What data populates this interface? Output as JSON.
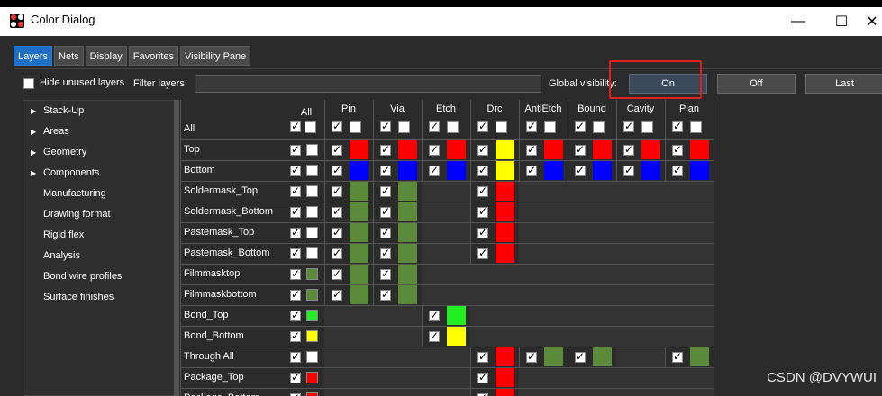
{
  "window": {
    "title": "Color Dialog",
    "controls": [
      "minimize-icon",
      "maximize-icon",
      "close-icon"
    ]
  },
  "tabs": [
    {
      "label": "Layers",
      "active": true
    },
    {
      "label": "Nets",
      "active": false
    },
    {
      "label": "Display",
      "active": false
    },
    {
      "label": "Favorites",
      "active": false
    },
    {
      "label": "Visibility Pane",
      "active": false
    }
  ],
  "filter": {
    "hide_unused_label": "Hide unused layers",
    "hide_unused_checked": false,
    "filter_label": "Filter layers:",
    "filter_value": "",
    "global_visibility_label": "Global visibility:",
    "buttons": {
      "on": "On",
      "off": "Off",
      "last": "Last"
    }
  },
  "tree": {
    "items": [
      {
        "label": "Stack-Up",
        "expandable": true
      },
      {
        "label": "Areas",
        "expandable": true
      },
      {
        "label": "Geometry",
        "expandable": true
      },
      {
        "label": "Components",
        "expandable": true
      },
      {
        "label": "Manufacturing",
        "expandable": false
      },
      {
        "label": "Drawing format",
        "expandable": false
      },
      {
        "label": "Rigid flex",
        "expandable": false
      },
      {
        "label": "Analysis",
        "expandable": false
      },
      {
        "label": "Bond wire profiles",
        "expandable": false
      },
      {
        "label": "Surface finishes",
        "expandable": false
      }
    ]
  },
  "grid": {
    "all_label": "All",
    "columns": [
      "Pin",
      "Via",
      "Etch",
      "Drc",
      "AntiEtch",
      "Bound",
      "Cavity",
      "Plan"
    ],
    "colors": {
      "red": "#ff0000",
      "blue": "#0000ff",
      "yellow": "#ffff00",
      "olive": "#5b8a3a",
      "green": "#22ee22",
      "white": "#ffffff"
    },
    "rows": [
      {
        "name": "All",
        "all_color": "white",
        "cells": [
          "white",
          "white",
          "white",
          "white",
          "white",
          "white",
          "white",
          "white"
        ]
      },
      {
        "name": "Top",
        "all_color": "white",
        "cells": [
          "red",
          "red",
          "red",
          "yellow",
          "red",
          "red",
          "red",
          "red"
        ]
      },
      {
        "name": "Bottom",
        "all_color": "white",
        "cells": [
          "blue",
          "blue",
          "blue",
          "yellow",
          "blue",
          "blue",
          "blue",
          "blue"
        ]
      },
      {
        "name": "Soldermask_Top",
        "all_color": "white",
        "cells": [
          "olive",
          "olive",
          "",
          "red",
          "",
          "",
          "",
          ""
        ]
      },
      {
        "name": "Soldermask_Bottom",
        "all_color": "white",
        "cells": [
          "olive",
          "olive",
          "",
          "red",
          "",
          "",
          "",
          ""
        ]
      },
      {
        "name": "Pastemask_Top",
        "all_color": "white",
        "cells": [
          "olive",
          "olive",
          "",
          "red",
          "",
          "",
          "",
          ""
        ]
      },
      {
        "name": "Pastemask_Bottom",
        "all_color": "white",
        "cells": [
          "olive",
          "olive",
          "",
          "red",
          "",
          "",
          "",
          ""
        ]
      },
      {
        "name": "Filmmasktop",
        "all_color": "olive",
        "cells": [
          "olive",
          "olive",
          "",
          "",
          "",
          "",
          "",
          ""
        ]
      },
      {
        "name": "Filmmaskbottom",
        "all_color": "olive",
        "cells": [
          "olive",
          "olive",
          "",
          "",
          "",
          "",
          "",
          ""
        ]
      },
      {
        "name": "Bond_Top",
        "all_color": "green",
        "cells": [
          "",
          "",
          "green",
          "",
          "",
          "",
          "",
          ""
        ]
      },
      {
        "name": "Bond_Bottom",
        "all_color": "yellow",
        "cells": [
          "",
          "",
          "yellow",
          "",
          "",
          "",
          "",
          ""
        ]
      },
      {
        "name": "Through All",
        "all_color": "white",
        "cells": [
          "",
          "",
          "",
          "red",
          "olive",
          "olive",
          "",
          "olive"
        ]
      },
      {
        "name": "Package_Top",
        "all_color": "red",
        "cells": [
          "",
          "",
          "",
          "red",
          "",
          "",
          "",
          ""
        ]
      },
      {
        "name": "Package_Bottom",
        "all_color": "red",
        "cells": [
          "",
          "",
          "",
          "red",
          "",
          "",
          "",
          ""
        ]
      }
    ]
  },
  "watermark": "CSDN @DVYWUI"
}
